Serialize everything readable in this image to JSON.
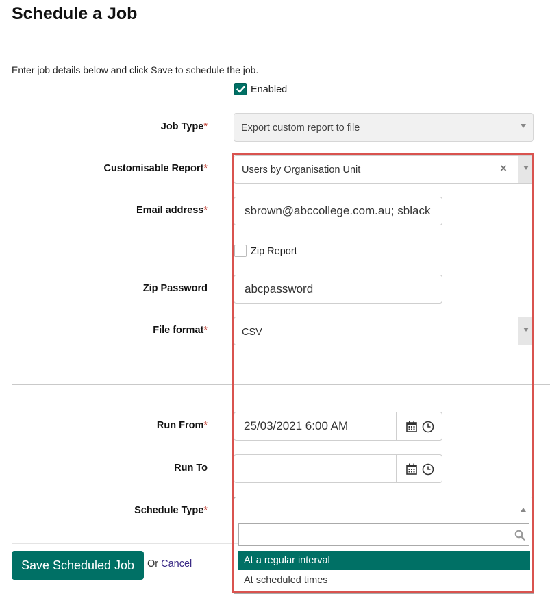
{
  "page": {
    "title": "Schedule a Job",
    "intro": "Enter job details below and click Save to schedule the job."
  },
  "enabled": {
    "label": "Enabled",
    "checked": true
  },
  "job_type": {
    "label": "Job Type",
    "required_mark": "*",
    "value": "Export custom report to file",
    "disabled": true
  },
  "customisable_report": {
    "label": "Customisable Report",
    "required_mark": "*",
    "value": "Users by Organisation Unit",
    "clear_glyph": "×"
  },
  "email": {
    "label": "Email address",
    "required_mark": "*",
    "value": "sbrown@abccollege.com.au; sblack"
  },
  "zip_report": {
    "label": "Zip Report",
    "checked": false
  },
  "zip_password": {
    "label": "Zip Password",
    "value": "abcpassword"
  },
  "file_format": {
    "label": "File format",
    "required_mark": "*",
    "value": "CSV"
  },
  "run_from": {
    "label": "Run From",
    "required_mark": "*",
    "value": "25/03/2021 6:00 AM"
  },
  "run_to": {
    "label": "Run To",
    "value": ""
  },
  "schedule_type": {
    "label": "Schedule Type",
    "required_mark": "*",
    "value": "",
    "search_value": "",
    "options": [
      "At a regular interval",
      "At scheduled times"
    ],
    "highlighted_index": 0
  },
  "actions": {
    "save_label": "Save Scheduled Job",
    "or_text": "Or",
    "cancel_label": "Cancel"
  },
  "colors": {
    "accent": "#007065",
    "required": "#c0392b",
    "highlight_border": "#d9534f",
    "link": "#3b2a86"
  },
  "icons": {
    "check": "check-icon",
    "calendar": "calendar-icon",
    "clock": "clock-icon",
    "search": "search-icon",
    "clear": "clear-icon"
  }
}
